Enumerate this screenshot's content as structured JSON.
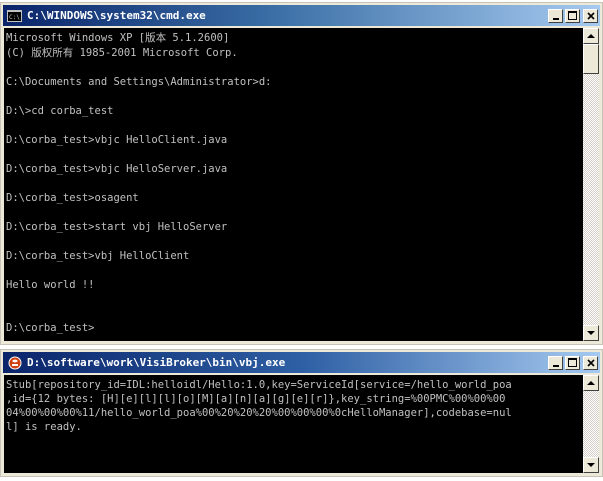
{
  "window_main": {
    "title": "C:\\WINDOWS\\system32\\cmd.exe",
    "lines": [
      "Microsoft Windows XP [版本 5.1.2600]",
      "(C) 版权所有 1985-2001 Microsoft Corp.",
      "",
      "C:\\Documents and Settings\\Administrator>d:",
      "",
      "D:\\>cd corba_test",
      "",
      "D:\\corba_test>vbjc HelloClient.java",
      "",
      "D:\\corba_test>vbjc HelloServer.java",
      "",
      "D:\\corba_test>osagent",
      "",
      "D:\\corba_test>start vbj HelloServer",
      "",
      "D:\\corba_test>vbj HelloClient",
      "",
      "Hello world !!",
      "",
      "",
      "D:\\corba_test>"
    ]
  },
  "window_secondary": {
    "title": "D:\\software\\work\\VisiBroker\\bin\\vbj.exe",
    "lines": [
      "Stub[repository_id=IDL:helloidl/Hello:1.0,key=ServiceId[service=/hello_world_poa",
      ",id={12 bytes: [H][e][l][l][o][M][a][n][a][g][e][r]},key_string=%00PMC%00%00%00",
      "04%00%00%00%11/hello_world_poa%00%20%20%20%00%00%00%0cHelloManager],codebase=nul",
      "l] is ready."
    ]
  },
  "colors": {
    "console_bg": "#000000",
    "console_fg": "#c0c0c0",
    "titlebar_active": "#0a246a",
    "chrome": "#ece9d8"
  },
  "icons": {
    "main_app": "cmd-icon",
    "secondary_app": "java-icon",
    "minimize": "minimize-icon",
    "maximize": "maximize-icon",
    "close": "close-icon"
  }
}
